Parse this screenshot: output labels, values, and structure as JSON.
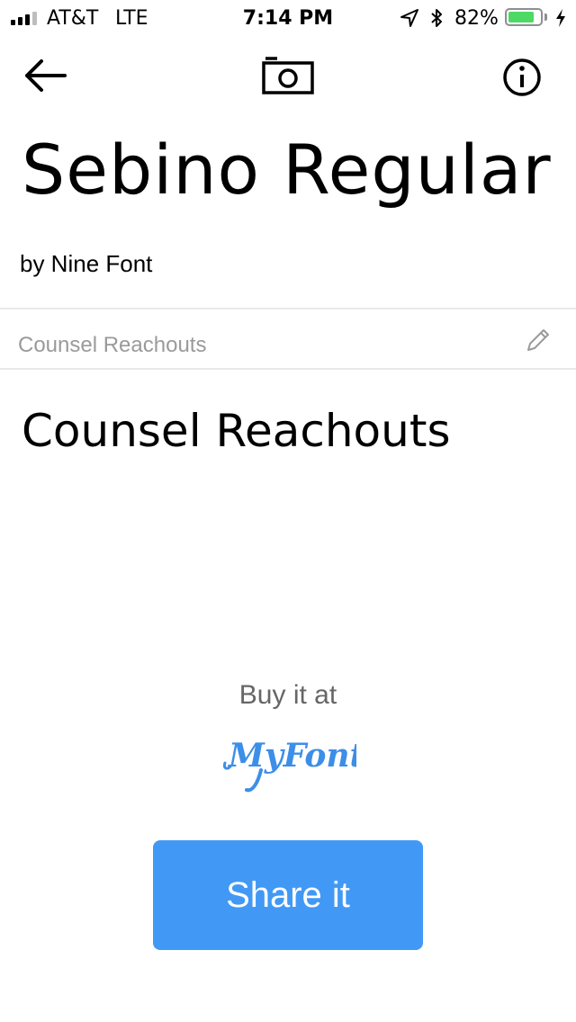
{
  "status_bar": {
    "carrier": "AT&T",
    "network": "LTE",
    "time": "7:14 PM",
    "battery_pct": "82%",
    "battery_level": 0.82,
    "battery_color": "#4cd964",
    "icons": [
      "signal-icon",
      "location-icon",
      "bluetooth-icon",
      "battery-icon",
      "charging-bolt-icon"
    ]
  },
  "nav": {
    "icons": [
      "back-arrow-icon",
      "camera-icon",
      "info-icon"
    ]
  },
  "font": {
    "name": "Sebino Regular",
    "foundry": "by Nine Font"
  },
  "sample": {
    "placeholder": "Counsel Reachouts",
    "preview_text": "Counsel Reachouts",
    "edit_icon": "pencil-icon"
  },
  "purchase": {
    "label": "Buy it at",
    "logo_text": "MyFonts",
    "logo_color": "#3d8ee8"
  },
  "share": {
    "label": "Share it",
    "color": "#4199f5"
  }
}
